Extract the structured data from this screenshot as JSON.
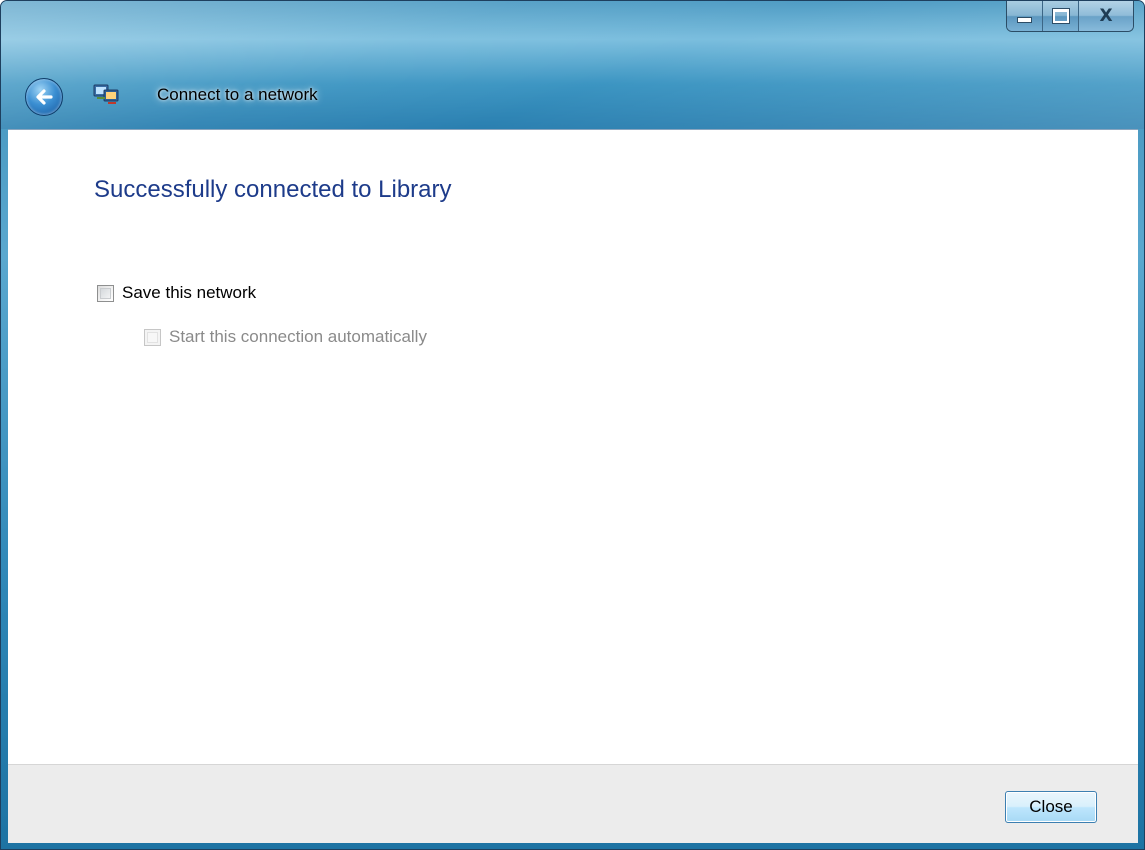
{
  "window": {
    "title": "Connect to a network",
    "controls": {
      "minimize": "minimize-icon",
      "maximize": "maximize-icon",
      "close": "X"
    },
    "back_icon": "back-arrow-icon",
    "app_icon": "network-connection-icon"
  },
  "main": {
    "heading": "Successfully connected to  Library",
    "save_network_label": "Save this network",
    "save_network_checked": false,
    "auto_start_label": "Start this connection automatically",
    "auto_start_checked": false,
    "auto_start_enabled": false
  },
  "footer": {
    "close_label": "Close"
  },
  "colors": {
    "heading": "#1d3b8a",
    "titlebar": "#3c95c2",
    "disabled_text": "#8a8a8a"
  }
}
